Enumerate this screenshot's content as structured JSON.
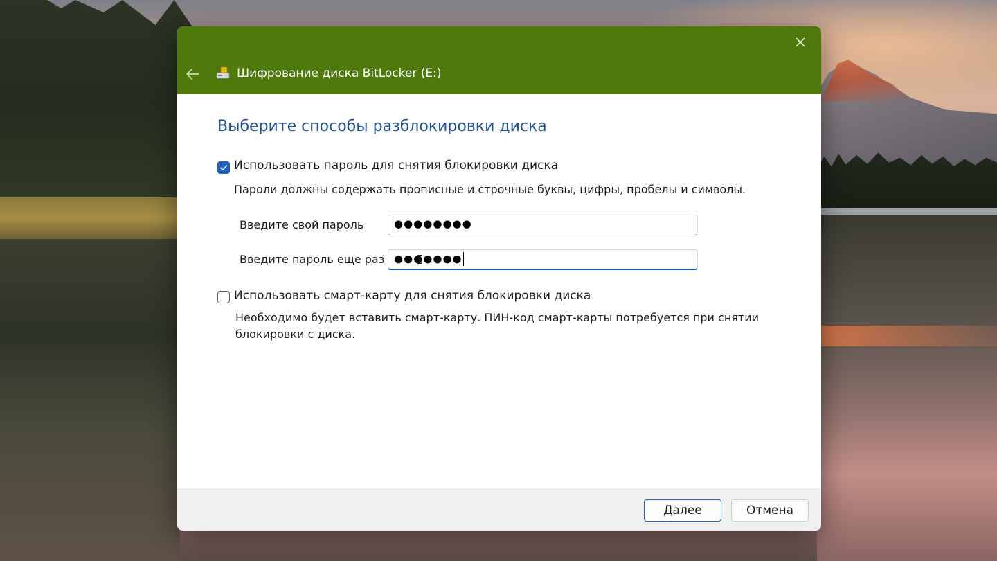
{
  "window": {
    "title": "Шифрование диска BitLocker (E:)"
  },
  "page": {
    "heading": "Выберите способы разблокировки диска"
  },
  "password_option": {
    "checked": true,
    "label": "Использовать пароль для снятия блокировки диска",
    "description": "Пароли должны содержать прописные и строчные буквы, цифры, пробелы и символы.",
    "password_label": "Введите свой пароль",
    "password_value": "●●●●●●●●",
    "confirm_label": "Введите пароль еще раз",
    "confirm_value": "●●●●●●●"
  },
  "smartcard_option": {
    "checked": false,
    "label": "Использовать смарт-карту для снятия блокировки диска",
    "description": "Необходимо будет вставить смарт-карту. ПИН-код смарт-карты потребуется при снятии блокировки с диска."
  },
  "buttons": {
    "next": "Далее",
    "cancel": "Отмена"
  },
  "icons": {
    "back": "back-arrow-icon",
    "close": "close-icon",
    "app": "bitlocker-drive-icon"
  },
  "colors": {
    "titlebar": "#4d7a0b",
    "heading": "#1e4e97",
    "accent": "#1f5fbf"
  }
}
